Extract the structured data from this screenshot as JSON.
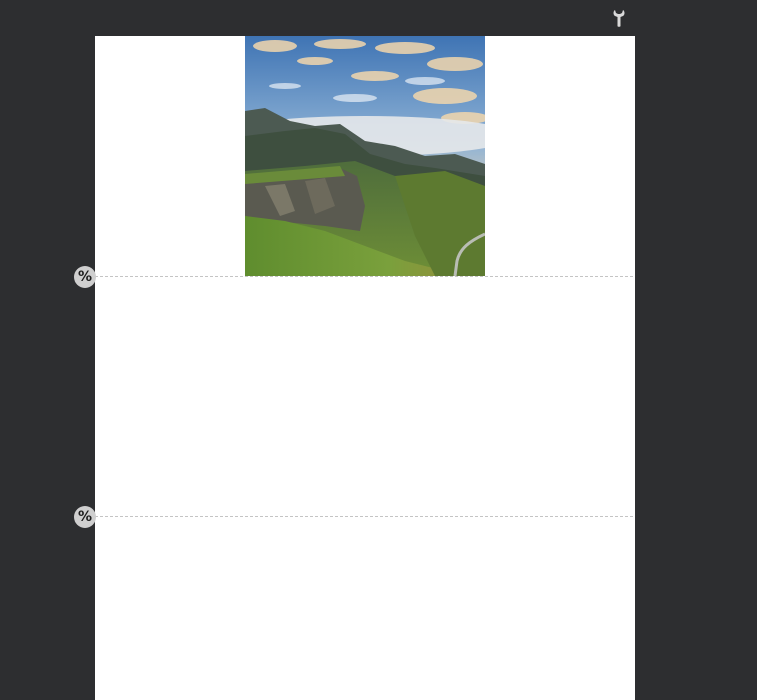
{
  "toolbar": {
    "settings_icon": "wrench-icon"
  },
  "canvas": {
    "image": {
      "subject": "mountain-landscape-photo",
      "colors": {
        "sky": "#5b8fc4",
        "cloud": "#e8c89a",
        "grass": "#6a8b3a"
      }
    },
    "sections": [
      {
        "handle_label": "%",
        "icon": "percent-icon"
      },
      {
        "handle_label": "%",
        "icon": "percent-icon"
      }
    ]
  },
  "colors": {
    "workspace_bg": "#2d2e30",
    "page_bg": "#ffffff",
    "guide_line": "#c4c4c4",
    "handle_bg": "#cfcfcf"
  }
}
